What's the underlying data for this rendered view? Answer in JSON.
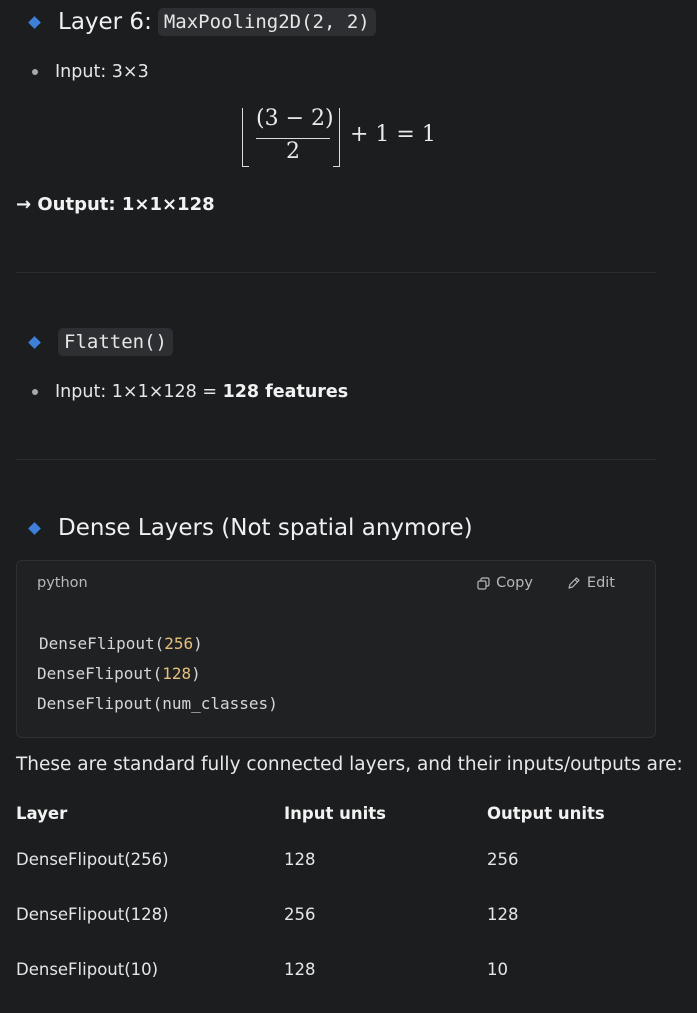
{
  "layer6": {
    "heading_label": "Layer 6:",
    "heading_code": "MaxPooling2D(2, 2)",
    "input": "Input: 3×3",
    "formula": {
      "numerator": "(3 − 2)",
      "denominator": "2",
      "rest": "+ 1 = 1"
    },
    "output": "→ Output: 1×1×128"
  },
  "flatten": {
    "heading_code": "Flatten()",
    "input_prefix": "Input: 1×1×128 = ",
    "input_bold": "128 features"
  },
  "dense": {
    "heading": "Dense Layers (Not spatial anymore)",
    "code_block": {
      "language": "python",
      "copy_label": "Copy",
      "edit_label": "Edit",
      "lines": [
        {
          "fn": "DenseFlipout(",
          "arg": "256",
          "end": ")"
        },
        {
          "fn": "DenseFlipout(",
          "arg": "128",
          "end": ")"
        },
        {
          "fn": "DenseFlipout(num_classes)",
          "arg": "",
          "end": ""
        }
      ]
    },
    "paragraph": "These are standard fully connected layers, and their inputs/outputs are:",
    "table": {
      "headers": [
        "Layer",
        "Input units",
        "Output units"
      ],
      "rows": [
        [
          "DenseFlipout(256)",
          "128",
          "256"
        ],
        [
          "DenseFlipout(128)",
          "256",
          "128"
        ],
        [
          "DenseFlipout(10)",
          "128",
          "10"
        ]
      ]
    }
  },
  "colors": {
    "background": "#1b1d1f",
    "accent_diamond": "#3d7fd9",
    "number_literal": "#e5c07b"
  }
}
